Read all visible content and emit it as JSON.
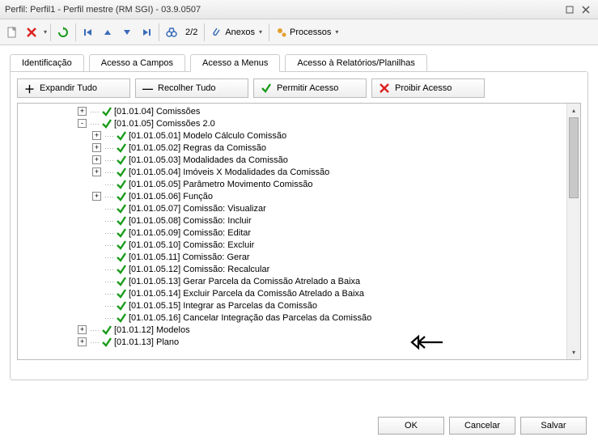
{
  "window": {
    "title": "Perfil: Perfil1 - Perfil mestre (RM SGI) - 03.9.0507",
    "minimize": "—",
    "close": "×"
  },
  "toolbar": {
    "page_counter": "2/2",
    "anexos": "Anexos",
    "processos": "Processos"
  },
  "tabs": [
    {
      "label": "Identificação"
    },
    {
      "label": "Acesso a Campos"
    },
    {
      "label": "Acesso a Menus"
    },
    {
      "label": "Acesso à Relatórios/Planilhas"
    }
  ],
  "actions": {
    "expand": "Expandir Tudo",
    "collapse": "Recolher Tudo",
    "permit": "Permitir Acesso",
    "deny": "Proibir Acesso"
  },
  "tree": [
    {
      "indent": 3,
      "exp": "+",
      "label": "[01.01.04] Comissões"
    },
    {
      "indent": 3,
      "exp": "-",
      "label": "[01.01.05] Comissões 2.0"
    },
    {
      "indent": 4,
      "exp": "+",
      "label": "[01.01.05.01] Modelo Cálculo Comissão"
    },
    {
      "indent": 4,
      "exp": "+",
      "label": "[01.01.05.02] Regras da Comissão"
    },
    {
      "indent": 4,
      "exp": "+",
      "label": "[01.01.05.03] Modalidades da Comissão"
    },
    {
      "indent": 4,
      "exp": "+",
      "label": "[01.01.05.04] Imóveis X Modalidades da Comissão"
    },
    {
      "indent": 4,
      "exp": "",
      "label": "[01.01.05.05] Parâmetro Movimento Comissão"
    },
    {
      "indent": 4,
      "exp": "+",
      "label": "[01.01.05.06] Função"
    },
    {
      "indent": 4,
      "exp": "",
      "label": "[01.01.05.07] Comissão: Visualizar"
    },
    {
      "indent": 4,
      "exp": "",
      "label": "[01.01.05.08] Comissão: Incluir"
    },
    {
      "indent": 4,
      "exp": "",
      "label": "[01.01.05.09] Comissão: Editar"
    },
    {
      "indent": 4,
      "exp": "",
      "label": "[01.01.05.10] Comissão: Excluir"
    },
    {
      "indent": 4,
      "exp": "",
      "label": "[01.01.05.11] Comissão: Gerar"
    },
    {
      "indent": 4,
      "exp": "",
      "label": "[01.01.05.12] Comissão: Recalcular"
    },
    {
      "indent": 4,
      "exp": "",
      "label": "[01.01.05.13] Gerar Parcela da Comissão Atrelado a Baixa"
    },
    {
      "indent": 4,
      "exp": "",
      "label": "[01.01.05.14] Excluir Parcela da Comissão Atrelado a Baixa"
    },
    {
      "indent": 4,
      "exp": "",
      "label": "[01.01.05.15] Integrar as Parcelas da Comissão"
    },
    {
      "indent": 4,
      "exp": "",
      "label": "[01.01.05.16] Cancelar Integração das Parcelas da Comissão"
    },
    {
      "indent": 3,
      "exp": "+",
      "label": "[01.01.12] Modelos"
    },
    {
      "indent": 3,
      "exp": "+",
      "label": "[01.01.13] Plano"
    }
  ],
  "footer": {
    "ok": "OK",
    "cancel": "Cancelar",
    "save": "Salvar"
  },
  "icons": {
    "plus": "＋",
    "minus": "—"
  }
}
